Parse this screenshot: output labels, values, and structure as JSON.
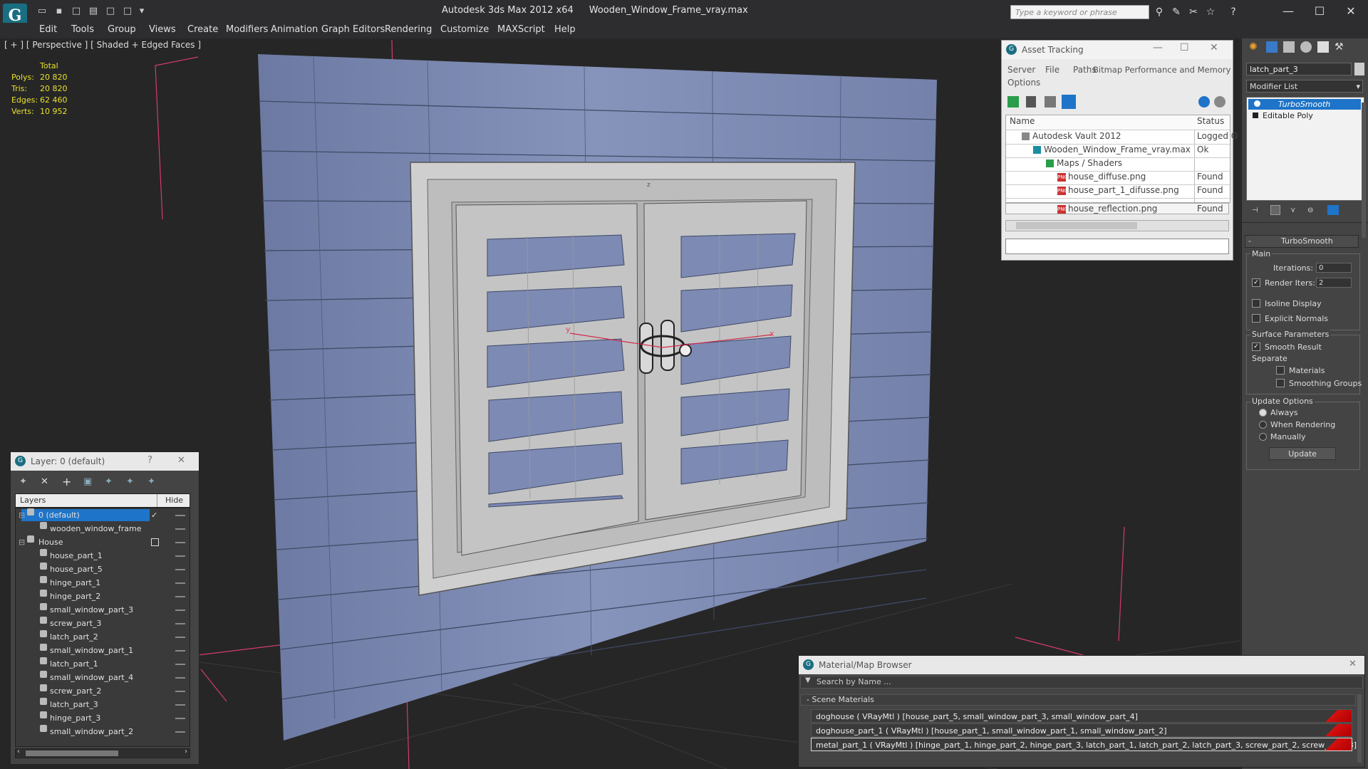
{
  "window": {
    "app_title": "Autodesk 3ds Max  2012 x64",
    "file_title": "Wooden_Window_Frame_vray.max",
    "search_placeholder": "Type a keyword or phrase",
    "logo_letter": "G"
  },
  "menu": [
    "Edit",
    "Tools",
    "Group",
    "Views",
    "Create",
    "Modifiers",
    "Animation",
    "Graph Editors",
    "Rendering",
    "Customize",
    "MAXScript",
    "Help"
  ],
  "viewport": {
    "label": "[ + ] [ Perspective ] [ Shaded + Edged Faces ]",
    "stats": {
      "header": "Total",
      "rows": [
        {
          "label": "Polys:",
          "value": "20 820"
        },
        {
          "label": "Tris:",
          "value": "20 820"
        },
        {
          "label": "Edges:",
          "value": "62 460"
        },
        {
          "label": "Verts:",
          "value": "10 952"
        }
      ]
    },
    "gizmo": {
      "x": "x",
      "y": "y",
      "z": "z"
    }
  },
  "asset_tracking": {
    "title": "Asset Tracking",
    "menu": [
      "Server",
      "File",
      "Paths",
      "Bitmap Performance and Memory",
      "Options"
    ],
    "columns": {
      "name": "Name",
      "status": "Status"
    },
    "rows": [
      {
        "name": "Autodesk Vault 2012",
        "status": "Logged O"
      },
      {
        "name": "Wooden_Window_Frame_vray.max",
        "status": "Ok"
      },
      {
        "name": "Maps / Shaders",
        "status": ""
      },
      {
        "name": "house_diffuse.png",
        "status": "Found"
      },
      {
        "name": "house_part_1_difusse.png",
        "status": "Found"
      },
      {
        "name": "house_reflection.png",
        "status": "Found"
      }
    ]
  },
  "command_panel": {
    "object_name": "latch_part_3",
    "modifier_list": "Modifier List",
    "stack": [
      "TurboSmooth",
      "Editable Poly"
    ],
    "rollout_title": "TurboSmooth",
    "main_label": "Main",
    "iterations_label": "Iterations:",
    "iterations_value": "0",
    "render_iters_label": "Render Iters:",
    "render_iters_value": "2",
    "isoline": "Isoline Display",
    "explicit_normals": "Explicit Normals",
    "surface_params": "Surface Parameters",
    "smooth_result": "Smooth Result",
    "separate": "Separate",
    "materials": "Materials",
    "smoothing_groups": "Smoothing Groups",
    "update_options": "Update Options",
    "always": "Always",
    "when_rendering": "When Rendering",
    "manually": "Manually",
    "update_button": "Update"
  },
  "layer_panel": {
    "title": "Layer: 0 (default)",
    "help": "?",
    "col_layers": "Layers",
    "col_hide": "Hide",
    "rows": [
      {
        "name": "0 (default)",
        "level": 0,
        "selected": true
      },
      {
        "name": "wooden_window_frame",
        "level": 1
      },
      {
        "name": "House",
        "level": 0
      },
      {
        "name": "house_part_1",
        "level": 1
      },
      {
        "name": "house_part_5",
        "level": 1
      },
      {
        "name": "hinge_part_1",
        "level": 1
      },
      {
        "name": "hinge_part_2",
        "level": 1
      },
      {
        "name": "small_window_part_3",
        "level": 1
      },
      {
        "name": "screw_part_3",
        "level": 1
      },
      {
        "name": "latch_part_2",
        "level": 1
      },
      {
        "name": "small_window_part_1",
        "level": 1
      },
      {
        "name": "latch_part_1",
        "level": 1
      },
      {
        "name": "small_window_part_4",
        "level": 1
      },
      {
        "name": "screw_part_2",
        "level": 1
      },
      {
        "name": "latch_part_3",
        "level": 1
      },
      {
        "name": "hinge_part_3",
        "level": 1
      },
      {
        "name": "small_window_part_2",
        "level": 1
      }
    ]
  },
  "material_browser": {
    "title": "Material/Map Browser",
    "search_placeholder": "Search by Name ...",
    "section": "- Scene Materials",
    "rows": [
      "doghouse  ( VRayMtl ) [house_part_5, small_window_part_3, small_window_part_4]",
      "doghouse_part_1  ( VRayMtl ) [house_part_1, small_window_part_1, small_window_part_2]",
      "metal_part_1  ( VRayMtl ) [hinge_part_1, hinge_part_2, hinge_part_3, latch_part_1, latch_part_2, latch_part_3, screw_part_2, screw_part_3]"
    ]
  },
  "colors": {
    "accent": "#1a6e82",
    "selection": "#1e74c8",
    "stats": "#e8e030",
    "wall": "#7a88b0"
  }
}
